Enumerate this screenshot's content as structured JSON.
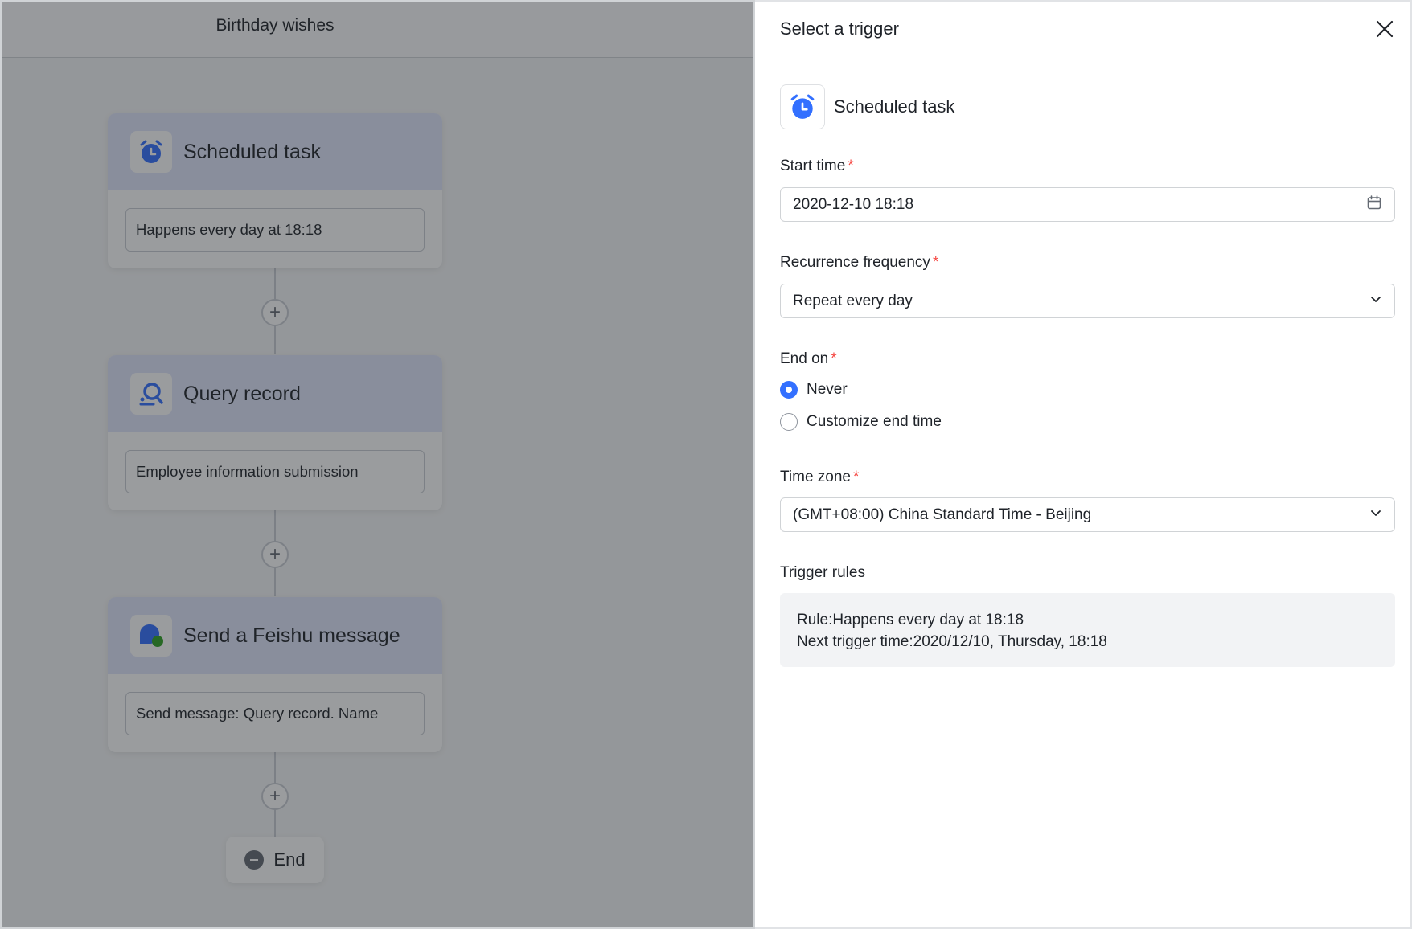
{
  "canvas": {
    "title": "Birthday wishes",
    "nodes": [
      {
        "title": "Scheduled task",
        "description": "Happens every day at 18:18",
        "icon": "alarm-clock-icon"
      },
      {
        "title": "Query record",
        "description": "Employee information submission",
        "icon": "query-record-icon"
      },
      {
        "title": "Send a Feishu message",
        "description": "Send message: Query record. Name",
        "icon": "message-bubble-icon"
      }
    ],
    "add_button": "+",
    "end_label": "End"
  },
  "drawer": {
    "title": "Select a trigger",
    "close_icon": "close-icon",
    "trigger_type": {
      "name": "Scheduled task",
      "icon": "alarm-clock-icon"
    },
    "required_mark": "*",
    "start_time": {
      "label": "Start time",
      "value": "2020-12-10 18:18",
      "icon": "calendar-icon"
    },
    "recurrence": {
      "label": "Recurrence frequency",
      "value": "Repeat every day",
      "icon": "chevron-down-icon"
    },
    "end_on": {
      "label": "End on",
      "options": [
        {
          "label": "Never",
          "checked": true
        },
        {
          "label": "Customize end time",
          "checked": false
        }
      ]
    },
    "time_zone": {
      "label": "Time zone",
      "value": "(GMT+08:00) China Standard Time - Beijing",
      "icon": "chevron-down-icon"
    },
    "trigger_rules": {
      "label": "Trigger rules",
      "rule": "Rule:Happens every day at 18:18",
      "next": "Next trigger time:2020/12/10, Thursday, 18:18"
    }
  },
  "colors": {
    "accent": "#3370ff",
    "required": "#f54a45",
    "node_header": "#e1e6fb",
    "message_green": "#2ea121"
  }
}
